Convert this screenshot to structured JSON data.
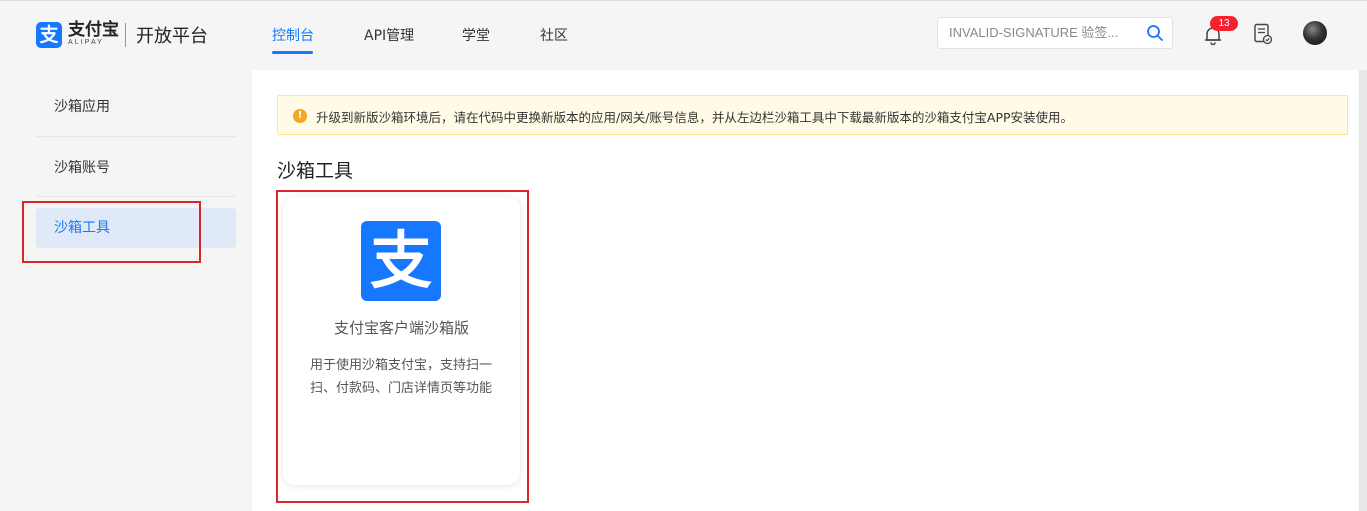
{
  "header": {
    "logo_glyph": "支",
    "brand_cn": "支付宝",
    "brand_en": "ALIPAY",
    "platform": "开放平台",
    "nav": [
      {
        "label": "控制台",
        "active": true
      },
      {
        "label": "API管理",
        "active": false
      },
      {
        "label": "学堂",
        "active": false
      },
      {
        "label": "社区",
        "active": false
      }
    ],
    "search": {
      "value": "INVALID-SIGNATURE 验签..."
    },
    "notifications_count": "13",
    "accent_color": "#1677ff"
  },
  "sidebar": {
    "items": [
      {
        "label": "沙箱应用",
        "active": false
      },
      {
        "label": "沙箱账号",
        "active": false
      },
      {
        "label": "沙箱工具",
        "active": true
      }
    ]
  },
  "main": {
    "notice": "升级到新版沙箱环境后，请在代码中更换新版本的应用/网关/账号信息，并从左边栏沙箱工具中下载最新版本的沙箱支付宝APP安装使用。",
    "notice_icon": "!",
    "section_title": "沙箱工具",
    "card": {
      "logo_glyph": "支",
      "title": "支付宝客户端沙箱版",
      "desc": "用于使用沙箱支付宝，支持扫一扫、付款码、门店详情页等功能"
    }
  }
}
